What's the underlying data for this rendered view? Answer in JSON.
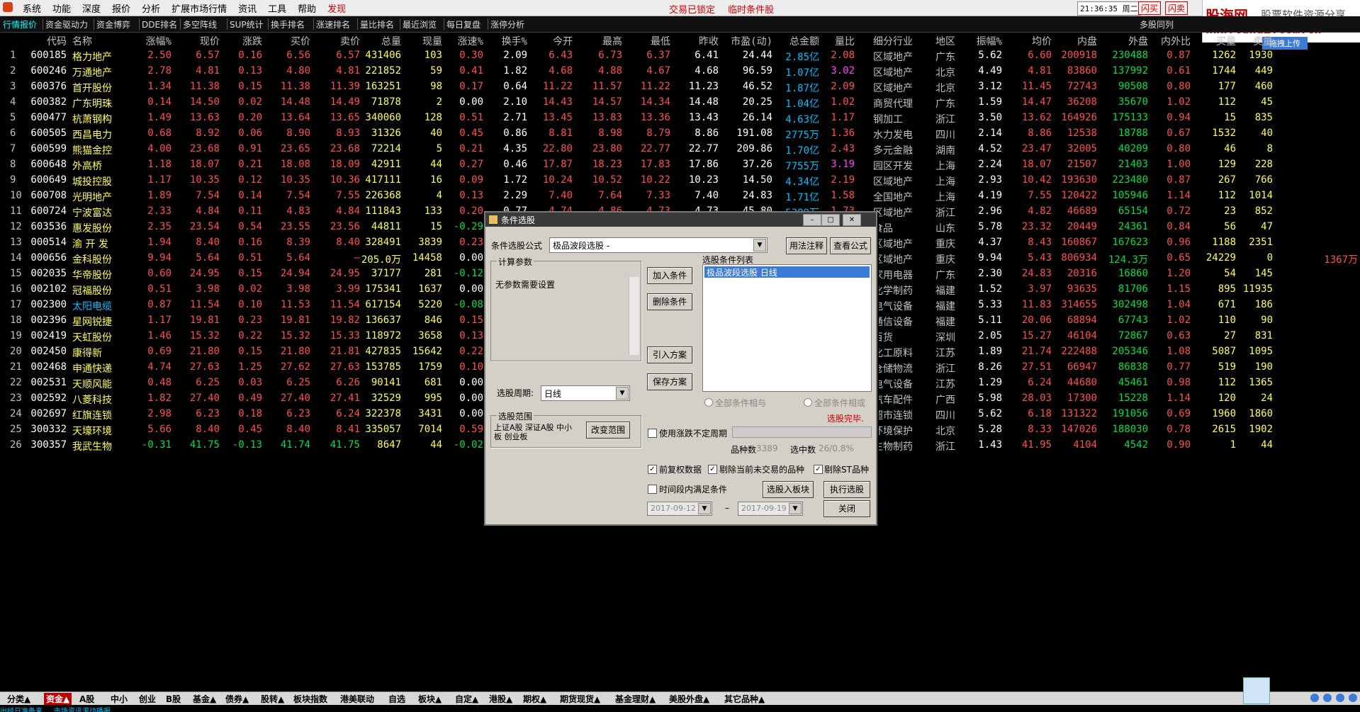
{
  "menubar": {
    "items": [
      "系统",
      "功能",
      "深度",
      "报价",
      "分析",
      "扩展市场行情",
      "资讯",
      "工具",
      "帮助",
      "发现"
    ],
    "status_left": "交易已锁定",
    "status_right": "临时条件股",
    "clock": "21:36:35 周二",
    "flash1": "闪买",
    "flash2": "闪卖"
  },
  "ad": {
    "brand": "股海网",
    "tagline": "股票软件资源分享",
    "url": "Www.Guhai.com.cn",
    "upload": "拖拽上传"
  },
  "tabs": [
    "行情报价",
    "资金驱动力",
    "资金博弈",
    "DDE排名",
    "多空阵线",
    "SUP统计",
    "换手排名",
    "涨速排名",
    "量比排名",
    "最近浏览",
    "每日复盘",
    "涨停分析"
  ],
  "tab_right": "多股同列",
  "columns": [
    "代码",
    "名称",
    "涨幅%",
    "现价",
    "涨跌",
    "买价",
    "卖价",
    "总量",
    "现量",
    "涨速%",
    "换手%",
    "今开",
    "最高",
    "最低",
    "昨收",
    "市盈(动)",
    "总金额",
    "量比",
    "细分行业",
    "地区",
    "振幅%",
    "均价",
    "内盘",
    "外盘",
    "内外比",
    "买量",
    "卖量"
  ],
  "rows": [
    [
      "1",
      "600185",
      "格力地产",
      "2.50",
      "6.57",
      "0.16",
      "6.56",
      "6.57",
      "431406",
      "103",
      "0.30",
      "2.09",
      "6.43",
      "6.73",
      "6.37",
      "6.41",
      "24.44",
      "2.85亿",
      "2.08",
      "区域地产",
      "广东",
      "5.62",
      "6.60",
      "200918",
      "230488",
      "0.87",
      "1262",
      "1930"
    ],
    [
      "2",
      "600246",
      "万通地产",
      "2.78",
      "4.81",
      "0.13",
      "4.80",
      "4.81",
      "221852",
      "59",
      "0.41",
      "1.82",
      "4.68",
      "4.88",
      "4.67",
      "4.68",
      "96.59",
      "1.07亿",
      "3.02",
      "区域地产",
      "北京",
      "4.49",
      "4.81",
      "83860",
      "137992",
      "0.61",
      "1744",
      "449"
    ],
    [
      "3",
      "600376",
      "首开股份",
      "1.34",
      "11.38",
      "0.15",
      "11.38",
      "11.39",
      "163251",
      "98",
      "0.17",
      "0.64",
      "11.22",
      "11.57",
      "11.22",
      "11.23",
      "46.52",
      "1.87亿",
      "2.09",
      "区域地产",
      "北京",
      "3.12",
      "11.45",
      "72743",
      "90508",
      "0.80",
      "177",
      "460"
    ],
    [
      "4",
      "600382",
      "广东明珠",
      "0.14",
      "14.50",
      "0.02",
      "14.48",
      "14.49",
      "71878",
      "2",
      "0.00",
      "2.10",
      "14.43",
      "14.57",
      "14.34",
      "14.48",
      "20.25",
      "1.04亿",
      "1.02",
      "商贸代理",
      "广东",
      "1.59",
      "14.47",
      "36208",
      "35670",
      "1.02",
      "112",
      "45"
    ],
    [
      "5",
      "600477",
      "杭萧钢构",
      "1.49",
      "13.63",
      "0.20",
      "13.64",
      "13.65",
      "340060",
      "128",
      "0.51",
      "2.71",
      "13.45",
      "13.83",
      "13.36",
      "13.43",
      "26.14",
      "4.63亿",
      "1.17",
      "钢加工",
      "浙江",
      "3.50",
      "13.62",
      "164926",
      "175133",
      "0.94",
      "15",
      "835"
    ],
    [
      "6",
      "600505",
      "西昌电力",
      "0.68",
      "8.92",
      "0.06",
      "8.90",
      "8.93",
      "31326",
      "40",
      "0.45",
      "0.86",
      "8.81",
      "8.98",
      "8.79",
      "8.86",
      "191.08",
      "2775万",
      "1.36",
      "水力发电",
      "四川",
      "2.14",
      "8.86",
      "12538",
      "18788",
      "0.67",
      "1532",
      "40"
    ],
    [
      "7",
      "600599",
      "熊猫金控",
      "4.00",
      "23.68",
      "0.91",
      "23.65",
      "23.68",
      "72214",
      "5",
      "0.21",
      "4.35",
      "22.80",
      "23.80",
      "22.77",
      "22.77",
      "209.86",
      "1.70亿",
      "2.43",
      "多元金融",
      "湖南",
      "4.52",
      "23.47",
      "32005",
      "40209",
      "0.80",
      "46",
      "8"
    ],
    [
      "8",
      "600648",
      "外高桥",
      "1.18",
      "18.07",
      "0.21",
      "18.08",
      "18.09",
      "42911",
      "44",
      "0.27",
      "0.46",
      "17.87",
      "18.23",
      "17.83",
      "17.86",
      "37.26",
      "7755万",
      "3.19",
      "园区开发",
      "上海",
      "2.24",
      "18.07",
      "21507",
      "21403",
      "1.00",
      "129",
      "228"
    ],
    [
      "9",
      "600649",
      "城投控股",
      "1.17",
      "10.35",
      "0.12",
      "10.35",
      "10.36",
      "417111",
      "16",
      "0.09",
      "1.72",
      "10.24",
      "10.52",
      "10.22",
      "10.23",
      "14.50",
      "4.34亿",
      "2.19",
      "区域地产",
      "上海",
      "2.93",
      "10.42",
      "193630",
      "223480",
      "0.87",
      "267",
      "766"
    ],
    [
      "10",
      "600708",
      "光明地产",
      "1.89",
      "7.54",
      "0.14",
      "7.54",
      "7.55",
      "226368",
      "4",
      "0.13",
      "2.29",
      "7.40",
      "7.64",
      "7.33",
      "7.40",
      "24.83",
      "1.71亿",
      "1.58",
      "全国地产",
      "上海",
      "4.19",
      "7.55",
      "120422",
      "105946",
      "1.14",
      "112",
      "1014"
    ],
    [
      "11",
      "600724",
      "宁波富达",
      "2.33",
      "4.84",
      "0.11",
      "4.83",
      "4.84",
      "111843",
      "133",
      "0.20",
      "0.77",
      "4.74",
      "4.86",
      "4.73",
      "4.73",
      "45.80",
      "5389万",
      "1.73",
      "区域地产",
      "浙江",
      "2.96",
      "4.82",
      "46689",
      "65154",
      "0.72",
      "23",
      "852"
    ],
    [
      "12",
      "603536",
      "惠发股份",
      "2.35",
      "23.54",
      "0.54",
      "23.55",
      "23.56",
      "44811",
      "15",
      "-0.29",
      "",
      "",
      "",
      "",
      "",
      "",
      "",
      "",
      "食品",
      "山东",
      "5.78",
      "23.32",
      "20449",
      "24361",
      "0.84",
      "56",
      "47"
    ],
    [
      "13",
      "000514",
      "渝 开 发",
      "1.94",
      "8.40",
      "0.16",
      "8.39",
      "8.40",
      "328491",
      "3839",
      "0.23",
      "",
      "",
      "",
      "",
      "",
      "",
      "",
      "",
      "区域地产",
      "重庆",
      "4.37",
      "8.43",
      "160867",
      "167623",
      "0.96",
      "1188",
      "2351"
    ],
    [
      "14",
      "000656",
      "金科股份",
      "9.94",
      "5.64",
      "0.51",
      "5.64",
      "–",
      "205.0万",
      "14458",
      "0.00",
      "",
      "",
      "",
      "",
      "",
      "",
      "",
      "",
      "区域地产",
      "重庆",
      "9.94",
      "5.43",
      "806934",
      "124.3万",
      "0.65",
      "24229",
      "0"
    ],
    [
      "15",
      "002035",
      "华帝股份",
      "0.60",
      "24.95",
      "0.15",
      "24.94",
      "24.95",
      "37177",
      "281",
      "-0.12",
      "",
      "",
      "",
      "",
      "",
      "",
      "",
      "",
      "家用电器",
      "广东",
      "2.30",
      "24.83",
      "20316",
      "16860",
      "1.20",
      "54",
      "145"
    ],
    [
      "16",
      "002102",
      "冠福股份",
      "0.51",
      "3.98",
      "0.02",
      "3.98",
      "3.99",
      "175341",
      "1637",
      "0.00",
      "",
      "",
      "",
      "",
      "",
      "",
      "",
      "",
      "化学制药",
      "福建",
      "1.52",
      "3.97",
      "93635",
      "81706",
      "1.15",
      "895",
      "11935"
    ],
    [
      "17",
      "002300",
      "太阳电缆",
      "0.87",
      "11.54",
      "0.10",
      "11.53",
      "11.54",
      "617154",
      "5220",
      "-0.08",
      "",
      "",
      "",
      "",
      "",
      "",
      "",
      "",
      "电气设备",
      "福建",
      "5.33",
      "11.83",
      "314655",
      "302498",
      "1.04",
      "671",
      "186"
    ],
    [
      "18",
      "002396",
      "星网锐捷",
      "1.17",
      "19.81",
      "0.23",
      "19.81",
      "19.82",
      "136637",
      "846",
      "0.15",
      "",
      "",
      "",
      "",
      "",
      "",
      "",
      "",
      "通信设备",
      "福建",
      "5.11",
      "20.06",
      "68894",
      "67743",
      "1.02",
      "110",
      "90"
    ],
    [
      "19",
      "002419",
      "天虹股份",
      "1.46",
      "15.32",
      "0.22",
      "15.32",
      "15.33",
      "118972",
      "3658",
      "0.13",
      "",
      "",
      "",
      "",
      "",
      "",
      "",
      "",
      "百货",
      "深圳",
      "2.05",
      "15.27",
      "46104",
      "72867",
      "0.63",
      "27",
      "831"
    ],
    [
      "20",
      "002450",
      "康得新",
      "0.69",
      "21.80",
      "0.15",
      "21.80",
      "21.81",
      "427835",
      "15642",
      "0.22",
      "",
      "",
      "",
      "",
      "",
      "",
      "",
      "",
      "化工原料",
      "江苏",
      "1.89",
      "21.74",
      "222488",
      "205346",
      "1.08",
      "5087",
      "1095"
    ],
    [
      "21",
      "002468",
      "申通快递",
      "4.74",
      "27.63",
      "1.25",
      "27.62",
      "27.63",
      "153785",
      "1759",
      "0.10",
      "",
      "",
      "",
      "",
      "",
      "",
      "",
      "",
      "仓储物流",
      "浙江",
      "8.26",
      "27.51",
      "66947",
      "86838",
      "0.77",
      "519",
      "190"
    ],
    [
      "22",
      "002531",
      "天顺风能",
      "0.48",
      "6.25",
      "0.03",
      "6.25",
      "6.26",
      "90141",
      "681",
      "0.00",
      "",
      "",
      "",
      "",
      "",
      "",
      "",
      "",
      "电气设备",
      "江苏",
      "1.29",
      "6.24",
      "44680",
      "45461",
      "0.98",
      "112",
      "1365"
    ],
    [
      "23",
      "002592",
      "八菱科技",
      "1.82",
      "27.40",
      "0.49",
      "27.40",
      "27.41",
      "32529",
      "995",
      "0.00",
      "",
      "",
      "",
      "",
      "",
      "",
      "",
      "",
      "汽车配件",
      "广西",
      "5.98",
      "28.03",
      "17300",
      "15228",
      "1.14",
      "120",
      "24"
    ],
    [
      "24",
      "002697",
      "红旗连锁",
      "2.98",
      "6.23",
      "0.18",
      "6.23",
      "6.24",
      "322378",
      "3431",
      "0.00",
      "",
      "",
      "",
      "",
      "",
      "",
      "",
      "",
      "超市连锁",
      "四川",
      "5.62",
      "6.18",
      "131322",
      "191056",
      "0.69",
      "1960",
      "1860"
    ],
    [
      "25",
      "300332",
      "天壕环境",
      "5.66",
      "8.40",
      "0.45",
      "8.40",
      "8.41",
      "335057",
      "7014",
      "0.59",
      "",
      "",
      "",
      "",
      "",
      "",
      "",
      "",
      "环境保护",
      "北京",
      "5.28",
      "8.33",
      "147026",
      "188030",
      "0.78",
      "2615",
      "1902"
    ],
    [
      "26",
      "300357",
      "我武生物",
      "-0.31",
      "41.75",
      "-0.13",
      "41.74",
      "41.75",
      "8647",
      "44",
      "-0.02",
      "",
      "",
      "",
      "",
      "",
      "",
      "",
      "",
      "生物制药",
      "浙江",
      "1.43",
      "41.95",
      "4104",
      "4542",
      "0.90",
      "1",
      "44"
    ]
  ],
  "row14_extra": "1367万",
  "dialog": {
    "title": "条件选股",
    "formula_label": "条件选股公式",
    "formula_value": "极品波段选股 -",
    "btn_usage": "用法注释",
    "btn_view": "查看公式",
    "params_group": "计算参数",
    "params_text": "无参数需要设置",
    "period_label": "选股周期:",
    "period_value": "日线",
    "range_group": "选股范围",
    "range_text": "上证A股 深证A股 中小板 创业板",
    "btn_change_range": "改变范围",
    "btn_add": "加入条件",
    "btn_delete": "删除条件",
    "btn_import": "引入方案",
    "btn_save": "保存方案",
    "list_title": "选股条件列表",
    "list_item": "极品波段选股  日线",
    "radio_and": "全部条件相与",
    "radio_or": "全部条件相或",
    "done_text": "选股完毕.",
    "use_volatile": "使用涨跌不定周期",
    "count_label": "品种数",
    "count_value": "3389",
    "selected_label": "选中数",
    "selected_value": "26/0.8%",
    "chk_adjust": "前复权数据",
    "chk_exclude_untrade": "剔除当前未交易的品种",
    "chk_exclude_st": "剔除ST品种",
    "chk_period": "时间段内满足条件",
    "date_from": "2017-09-12",
    "date_to": "2017-09-19",
    "date_dash": "–",
    "btn_to_block": "选股入板块",
    "btn_run": "执行选股",
    "btn_close": "关闭"
  },
  "bottom_tabs": [
    "分类▲",
    "资金▲",
    "A股",
    "中小",
    "创业",
    "B股",
    "基金▲",
    "债券▲",
    "股转▲",
    "板块指数",
    "港美联动",
    "自选",
    "板块▲",
    "自定▲",
    "港股▲",
    "期权▲",
    "期货现货▲",
    "基金理财▲",
    "美股外盘▲",
    "其它品种▲"
  ],
  "ticker": "出经日准备来 ... 市场资讯滚动播报 ..."
}
